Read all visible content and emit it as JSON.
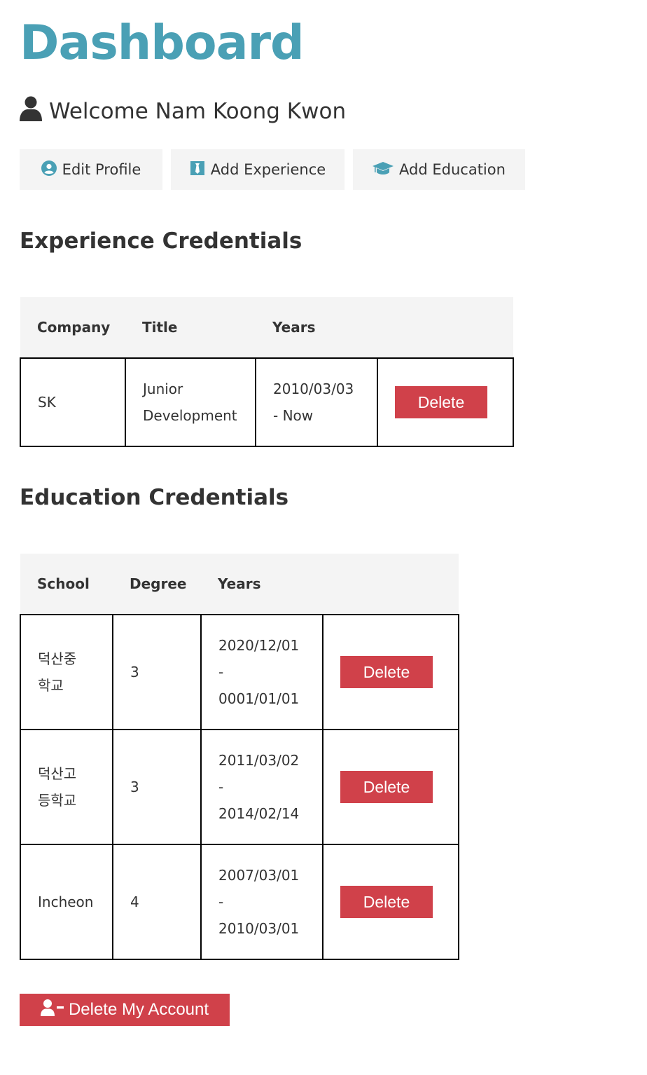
{
  "page_title": "Dashboard",
  "welcome": {
    "text": "Welcome Nam Koong Kwon",
    "icon": "user-icon"
  },
  "actions": [
    {
      "label": "Edit Profile",
      "icon": "user-circle-icon"
    },
    {
      "label": "Add Experience",
      "icon": "briefcase-icon"
    },
    {
      "label": "Add Education",
      "icon": "graduation-cap-icon"
    }
  ],
  "experience": {
    "heading": "Experience Credentials",
    "columns": [
      "Company",
      "Title",
      "Years"
    ],
    "rows": [
      {
        "company": "SK",
        "title_line1": "Junior",
        "title_line2": "Development",
        "years_line1": "2010/03/03",
        "years_line2": "- Now",
        "delete_label": "Delete"
      }
    ]
  },
  "education": {
    "heading": "Education Credentials",
    "columns": [
      "School",
      "Degree",
      "Years"
    ],
    "rows": [
      {
        "school_line1": "덕산중",
        "school_line2": "학교",
        "degree": "3",
        "from": "2020/12/01",
        "sep": "-",
        "to": "0001/01/01",
        "delete_label": "Delete"
      },
      {
        "school_line1": "덕산고",
        "school_line2": "등학교",
        "degree": "3",
        "from": "2011/03/02",
        "sep": "-",
        "to": "2014/02/14",
        "delete_label": "Delete"
      },
      {
        "school_line1": "Incheon",
        "school_line2": "",
        "degree": "4",
        "from": "2007/03/01",
        "sep": "-",
        "to": "2010/03/01",
        "delete_label": "Delete"
      }
    ]
  },
  "delete_account": {
    "label": "Delete My Account",
    "icon": "user-minus-icon"
  },
  "colors": {
    "brand": "#4aa0b5",
    "danger": "#d0414a",
    "light": "#f4f4f4",
    "text": "#333333"
  }
}
